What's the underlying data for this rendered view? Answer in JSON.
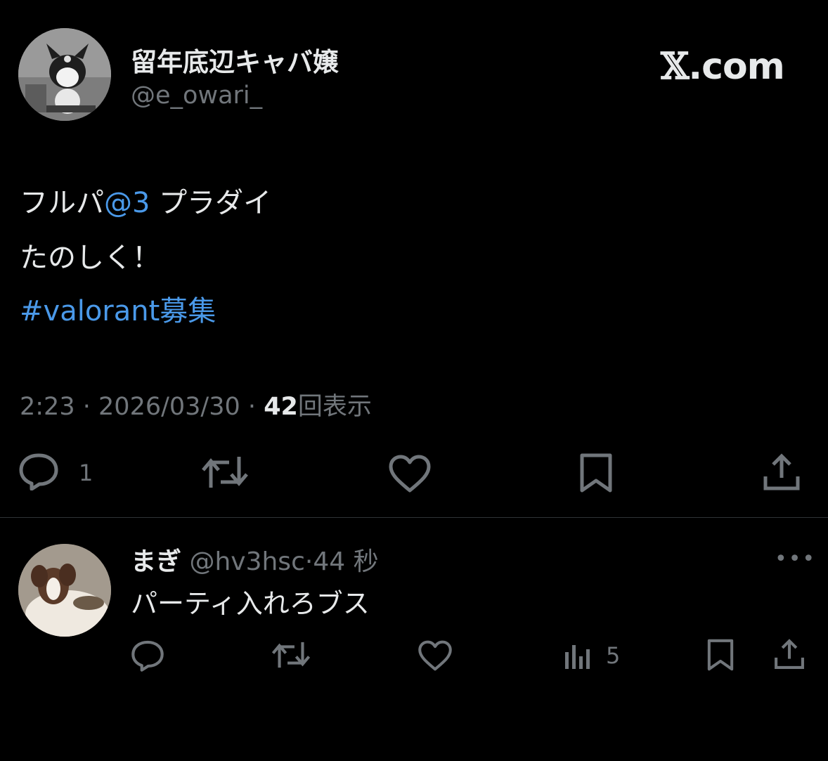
{
  "tweet": {
    "author_name": "留年底辺キャバ嬢",
    "author_handle": "@e_owari_",
    "brand": ".com",
    "lines": [
      {
        "plain": "フルパ",
        "link": "@3",
        "rest": " プラダイ"
      },
      {
        "plain": "たのしく！"
      },
      {
        "hashtag": " #valorant募集"
      }
    ],
    "time": "2:23",
    "date": "2026/03/30",
    "views_count": "42",
    "views_label": "回表示",
    "separator": "·",
    "reply_count": "1"
  },
  "reply": {
    "name": "まぎ",
    "handle": "@hv3hsc",
    "time": "44 秒",
    "separator": "·",
    "text": "パーティ入れろブス",
    "more": "•••",
    "views_count": "5"
  },
  "colors": {
    "link": "#4a99e9",
    "muted": "#71767b",
    "text": "#e7e9ea",
    "background": "#000000"
  },
  "icons": [
    "reply-icon",
    "retweet-icon",
    "like-icon",
    "bookmark-icon",
    "share-icon",
    "views-icon",
    "more-icon"
  ]
}
